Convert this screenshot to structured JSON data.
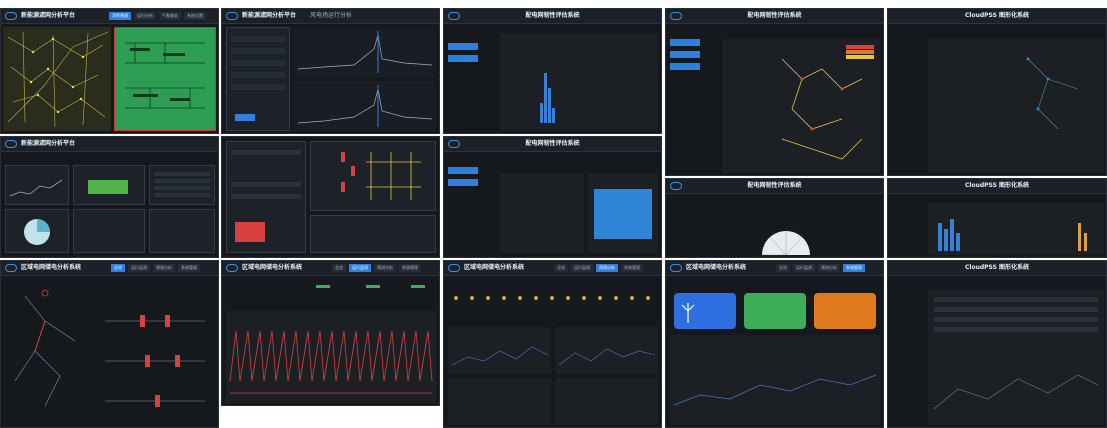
{
  "tiles": {
    "t1": {
      "title": "新能源滤网分析平台",
      "tabs": [
        "功率预测",
        "运行分析",
        "气象服务",
        "系统设置"
      ]
    },
    "t2": {
      "title": "新能源滤网分析平台",
      "subtitle": "风电场运行分析"
    },
    "t3": {
      "title": "新能源滤网分析平台"
    },
    "t4": {
      "title": "区域电网储电分析系统",
      "tabs": [
        "总览",
        "运行监测",
        "预测分析",
        "系统管理"
      ]
    },
    "t5": {
      "title": "区域电网储电分析系统",
      "tabs": [
        "总览",
        "运行监测",
        "预测分析",
        "系统管理"
      ]
    },
    "t6": {
      "title": "配电网韧性评估系统"
    },
    "t7": {
      "title": "配电网韧性评估系统"
    },
    "t8": {
      "title": "区域电网储电分析系统",
      "tabs": [
        "总览",
        "运行监测",
        "预测分析",
        "系统管理"
      ]
    },
    "t9": {
      "title": "配电网韧性评估系统"
    },
    "t10": {
      "title": "配电网韧性评估系统"
    },
    "t11": {
      "title": "区域电网储电分析系统",
      "tabs": [
        "总览",
        "运行监测",
        "预测分析",
        "系统管理"
      ]
    },
    "t12": {
      "title": "CloudPSS 图形化系统"
    },
    "t13": {
      "title": "CloudPSS 图形化系统"
    },
    "t14": {
      "title": "CloudPSS 图形化系统"
    }
  },
  "colors": {
    "accent": "#2d7fe0",
    "bg": "#15181d",
    "green": "#3fae5a",
    "red": "#d94040",
    "orange": "#e07a1f"
  }
}
